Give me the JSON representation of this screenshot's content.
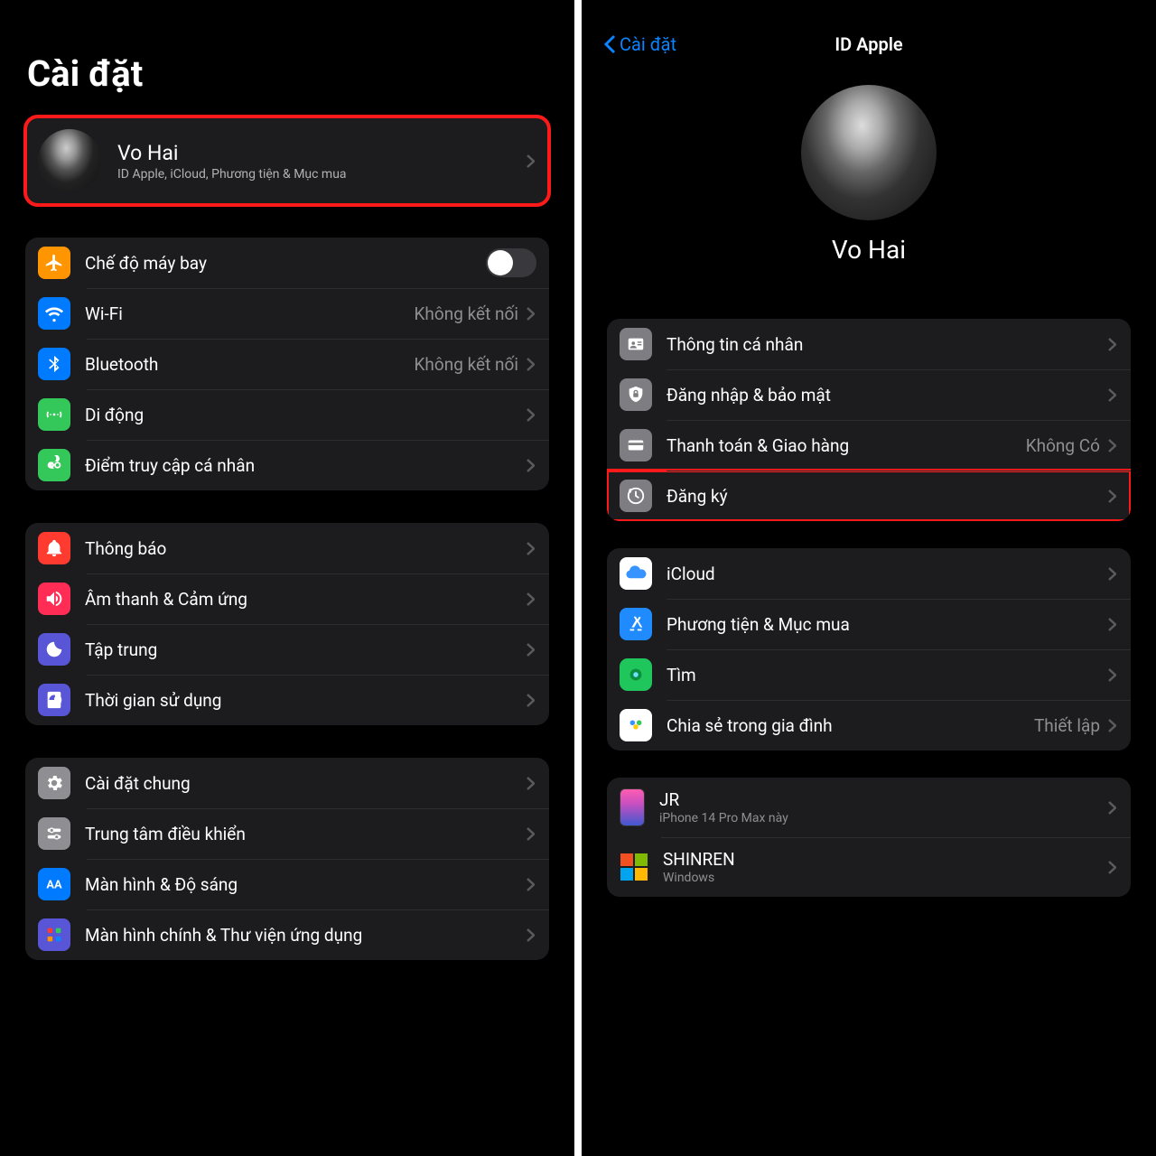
{
  "left": {
    "title": "Cài đặt",
    "profile": {
      "name": "Vo Hai",
      "sub": "ID Apple, iCloud, Phương tiện & Mục mua"
    },
    "group_network": {
      "airplane": "Chế độ máy bay",
      "wifi": "Wi-Fi",
      "wifi_val": "Không kết nối",
      "bluetooth": "Bluetooth",
      "bluetooth_val": "Không kết nối",
      "cellular": "Di động",
      "hotspot": "Điểm truy cập cá nhân"
    },
    "group_alerts": {
      "notifications": "Thông báo",
      "sound": "Âm thanh & Cảm ứng",
      "focus": "Tập trung",
      "screentime": "Thời gian sử dụng"
    },
    "group_general": {
      "general": "Cài đặt chung",
      "control": "Trung tâm điều khiển",
      "display": "Màn hình & Độ sáng",
      "home": "Màn hình chính & Thư viện ứng dụng"
    }
  },
  "right": {
    "back": "Cài đặt",
    "title": "ID Apple",
    "name": "Vo Hai",
    "group_account": {
      "personal": "Thông tin cá nhân",
      "security": "Đăng nhập & bảo mật",
      "payment": "Thanh toán & Giao hàng",
      "payment_val": "Không Có",
      "subscriptions": "Đăng ký"
    },
    "group_services": {
      "icloud": "iCloud",
      "media": "Phương tiện & Mục mua",
      "find": "Tìm",
      "family": "Chia sẻ trong gia đình",
      "family_val": "Thiết lập"
    },
    "devices": {
      "d1_name": "JR",
      "d1_sub": "iPhone 14 Pro Max này",
      "d2_name": "SHINREN",
      "d2_sub": "Windows"
    }
  }
}
